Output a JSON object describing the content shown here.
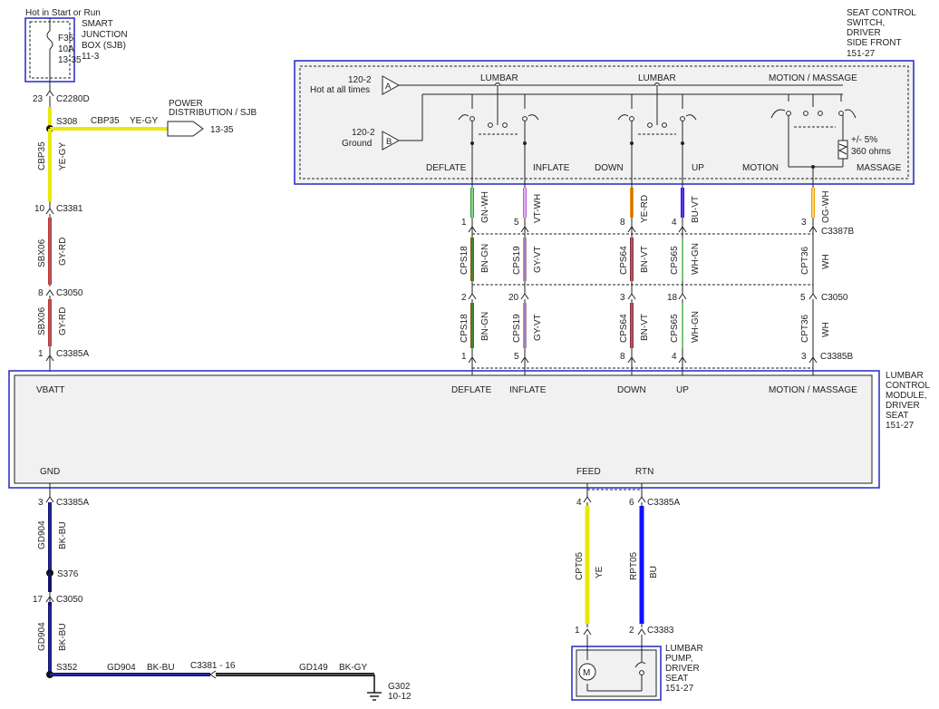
{
  "power": {
    "hot_label": "Hot in Start or Run",
    "fuse": {
      "name": "F35",
      "rating": "10A",
      "ref": "13-35"
    },
    "sjb_lines": [
      "SMART",
      "JUNCTION",
      "BOX (SJB)",
      "11-3"
    ]
  },
  "power_dist": {
    "lines": [
      "POWER",
      "DISTRIBUTION / SJB"
    ],
    "ref": "13-35"
  },
  "seat_switch": {
    "title_lines": [
      "SEAT CONTROL",
      "SWITCH,",
      "DRIVER",
      "SIDE FRONT",
      "151-27"
    ],
    "input_a": {
      "ref": "120-2",
      "desc": "Hot at all times",
      "letter": "A"
    },
    "input_b": {
      "ref": "120-2",
      "desc": "Ground",
      "letter": "B"
    },
    "group_labels": [
      "LUMBAR",
      "LUMBAR",
      "MOTION / MASSAGE"
    ],
    "position_labels": [
      "DEFLATE",
      "INFLATE",
      "DOWN",
      "UP",
      "MOTION",
      "MASSAGE"
    ],
    "resistor": {
      "tolerance": "+/- 5%",
      "value": "360 ohms"
    }
  },
  "left_circuit": {
    "c2280d": {
      "pin": "23",
      "name": "C2280D"
    },
    "s308": "S308",
    "branch": {
      "circuit": "CBP35",
      "color": "YE-GY"
    },
    "seg1": {
      "circuit": "CBP35",
      "color": "YE-GY"
    },
    "c3381": {
      "pin": "10",
      "name": "C3381"
    },
    "seg2": {
      "circuit": "SBX06",
      "color": "GY-RD"
    },
    "c3050": {
      "pin": "8",
      "name": "C3050"
    },
    "seg3": {
      "circuit": "SBX06",
      "color": "GY-RD"
    },
    "c3385a": {
      "pin": "1",
      "name": "C3385A"
    }
  },
  "harness_columns": [
    {
      "switch_pin": "1",
      "switch_color": "GN-WH",
      "mid_circuit": "CPS18",
      "mid_color": "BN-GN",
      "c3050_pin": "2",
      "low_circuit": "CPS18",
      "low_color": "BN-GN",
      "module_pin": "1"
    },
    {
      "switch_pin": "5",
      "switch_color": "VT-WH",
      "mid_circuit": "CPS19",
      "mid_color": "GY-VT",
      "c3050_pin": "20",
      "low_circuit": "CPS19",
      "low_color": "GY-VT",
      "module_pin": "5"
    },
    {
      "switch_pin": "8",
      "switch_color": "YE-RD",
      "mid_circuit": "CPS64",
      "mid_color": "BN-VT",
      "c3050_pin": "3",
      "low_circuit": "CPS64",
      "low_color": "BN-VT",
      "module_pin": "8"
    },
    {
      "switch_pin": "4",
      "switch_color": "BU-VT",
      "mid_circuit": "CPS65",
      "mid_color": "WH-GN",
      "c3050_pin": "18",
      "low_circuit": "CPS65",
      "low_color": "WH-GN",
      "module_pin": "4"
    },
    {
      "switch_pin": "3",
      "switch_color": "OG-WH",
      "mid_circuit": "CPT36",
      "mid_color": "WH",
      "c3050_pin": "5",
      "low_circuit": "CPT36",
      "low_color": "WH",
      "module_pin": "3"
    }
  ],
  "connectors": {
    "c3387b": "C3387B",
    "c3050": "C3050",
    "c3385b": "C3385B"
  },
  "module": {
    "title_lines": [
      "LUMBAR",
      "CONTROL",
      "MODULE,",
      "DRIVER",
      "SEAT",
      "151-27"
    ],
    "pin_labels": {
      "vbatt": "VBATT",
      "deflate": "DEFLATE",
      "inflate": "INFLATE",
      "down": "DOWN",
      "up": "UP",
      "motion_massage": "MOTION / MASSAGE",
      "gnd": "GND",
      "feed": "FEED",
      "rtn": "RTN"
    }
  },
  "ground_circuit": {
    "c3385a": {
      "pin": "3",
      "name": "C3385A"
    },
    "seg1": {
      "circuit": "GD904",
      "color": "BK-BU"
    },
    "s376": "S376",
    "c3050": {
      "pin": "17",
      "name": "C3050"
    },
    "seg2": {
      "circuit": "GD904",
      "color": "BK-BU"
    },
    "s352": "S352",
    "horiz": {
      "circuit": "GD904",
      "color": "BK-BU"
    },
    "c3381": "C3381 - 16",
    "gd149": {
      "circuit": "GD149",
      "color": "BK-GY"
    },
    "g302": {
      "name": "G302",
      "ref": "10-12"
    }
  },
  "pump_circuit": {
    "feed_pin": "4",
    "rtn_pin": "6",
    "connector": "C3385A",
    "feed_wire": {
      "circuit": "CPT05",
      "color": "YE"
    },
    "rtn_wire": {
      "circuit": "RPT05",
      "color": "BU"
    },
    "pump_pin1": "1",
    "pump_pin2": "2",
    "pump_connector": "C3383",
    "motor_symbol": "M",
    "pump_lines": [
      "LUMBAR",
      "PUMP,",
      "DRIVER",
      "SEAT",
      "151-27"
    ]
  },
  "colors": {
    "box_border": "#3333cc",
    "yellow": "#e8e80c",
    "red": "#c43030",
    "blue": "#1010ff",
    "navy": "#14146e",
    "green": "#22a022",
    "violet": "#c060e0",
    "brown_green": "#7a5a20"
  }
}
